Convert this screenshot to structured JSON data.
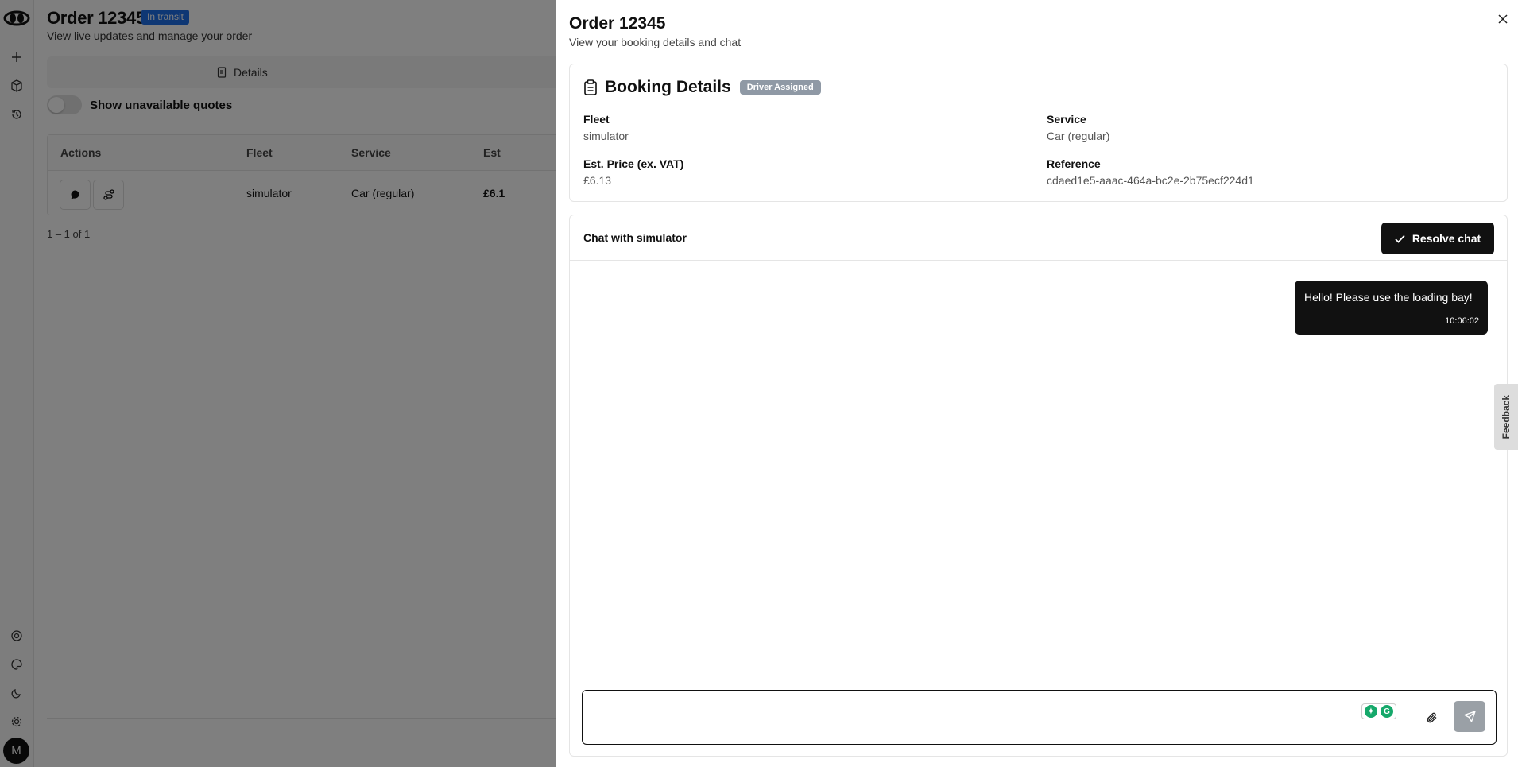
{
  "background": {
    "order_title": "Order 12345",
    "status_badge": "In transit",
    "subtitle": "View live updates and manage your order",
    "tab_details": "Details",
    "toggle_label": "Show unavailable quotes",
    "table": {
      "headers": [
        "Actions",
        "Fleet",
        "Service",
        "Est"
      ],
      "rows": [
        {
          "fleet": "simulator",
          "service": "Car (regular)",
          "est": "£6.1"
        }
      ]
    },
    "pagination": "1 – 1 of 1",
    "avatar_initial": "M"
  },
  "drawer": {
    "title": "Order 12345",
    "subtitle": "View your booking details and chat",
    "booking": {
      "title": "Booking Details",
      "badge": "Driver Assigned",
      "fleet_label": "Fleet",
      "fleet_value": "simulator",
      "service_label": "Service",
      "service_value": "Car (regular)",
      "price_label": "Est. Price (ex. VAT)",
      "price_value": "£6.13",
      "reference_label": "Reference",
      "reference_value": "cdaed1e5-aaac-464a-bc2e-2b75ecf224d1"
    },
    "chat": {
      "title": "Chat with simulator",
      "resolve_label": "Resolve chat",
      "messages": [
        {
          "text": "Hello! Please use the loading bay!",
          "time": "10:06:02"
        }
      ],
      "input_value": ""
    }
  },
  "feedback_label": "Feedback",
  "colors": {
    "status_badge": "#1d6fe8",
    "driver_badge": "#8f99a5",
    "primary_button": "#111111",
    "send_button": "#9aa0a6"
  }
}
